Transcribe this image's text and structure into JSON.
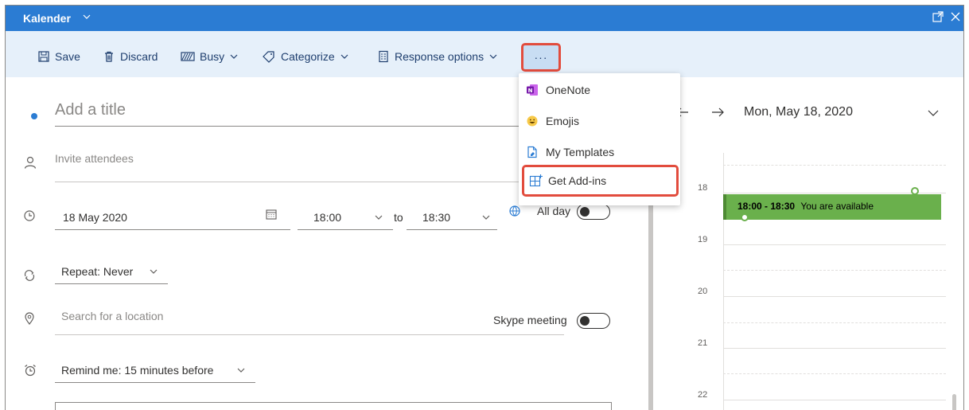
{
  "window": {
    "title": "Kalender"
  },
  "toolbar": {
    "save_label": "Save",
    "discard_label": "Discard",
    "busy_label": "Busy",
    "categorize_label": "Categorize",
    "response_label": "Response options",
    "more_label": "···"
  },
  "form": {
    "title_placeholder": "Add a title",
    "attendees_placeholder": "Invite attendees",
    "date": "18 May 2020",
    "start_time": "18:00",
    "to_label": "to",
    "end_time": "18:30",
    "all_day_label": "All day",
    "repeat_label": "Repeat: Never",
    "location_placeholder": "Search for a location",
    "skype_label": "Skype meeting",
    "remind_label": "Remind me: 15 minutes before"
  },
  "menu": {
    "items": [
      {
        "label": "OneNote",
        "icon": "onenote-icon"
      },
      {
        "label": "Emojis",
        "icon": "emoji-icon"
      },
      {
        "label": "My Templates",
        "icon": "templates-icon"
      },
      {
        "label": "Get Add-ins",
        "icon": "add-ins-icon"
      }
    ]
  },
  "calendar": {
    "date_label": "Mon, May 18, 2020",
    "hours": [
      "18",
      "19",
      "20",
      "21",
      "22"
    ],
    "event": {
      "time": "18:00 - 18:30",
      "status": "You are available"
    }
  },
  "colors": {
    "titlebar": "#2b7cd3",
    "toolbar": "#e6f0fa",
    "highlight": "#e24c3d",
    "event": "#6ab04c"
  }
}
